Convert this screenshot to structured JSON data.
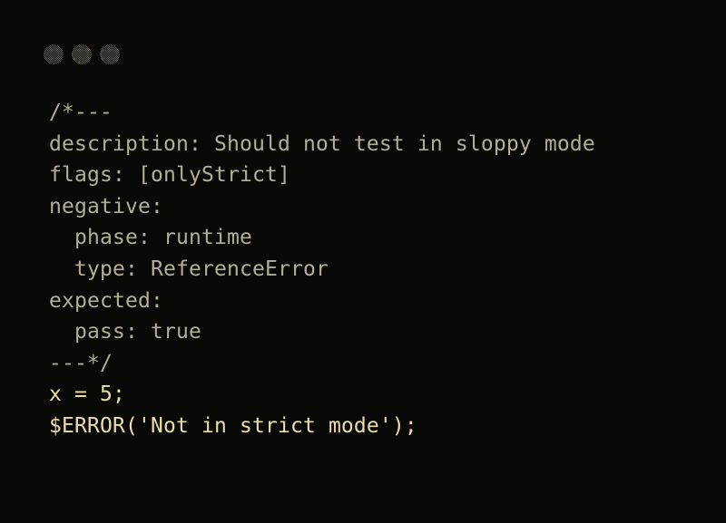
{
  "window": {
    "dots": [
      {
        "name": "window-dot-close",
        "color": "#6b6953"
      },
      {
        "name": "window-dot-minimize",
        "color": "#6b6953"
      },
      {
        "name": "window-dot-maximize",
        "color": "#6b6953"
      }
    ]
  },
  "theme": {
    "background": "#080806",
    "comment_color": "#b2ae98",
    "code_color": "#ecdea4"
  },
  "editor": {
    "lines": [
      {
        "text": "/*---",
        "tone": "comment"
      },
      {
        "text": "description: Should not test in sloppy mode",
        "tone": "comment"
      },
      {
        "text": "flags: [onlyStrict]",
        "tone": "comment"
      },
      {
        "text": "negative:",
        "tone": "comment"
      },
      {
        "text": "  phase: runtime",
        "tone": "comment"
      },
      {
        "text": "  type: ReferenceError",
        "tone": "comment"
      },
      {
        "text": "expected:",
        "tone": "comment"
      },
      {
        "text": "  pass: true",
        "tone": "comment"
      },
      {
        "text": "---*/",
        "tone": "comment"
      },
      {
        "text": "x = 5;",
        "tone": "code"
      },
      {
        "text": "$ERROR('Not in strict mode');",
        "tone": "code"
      }
    ]
  }
}
